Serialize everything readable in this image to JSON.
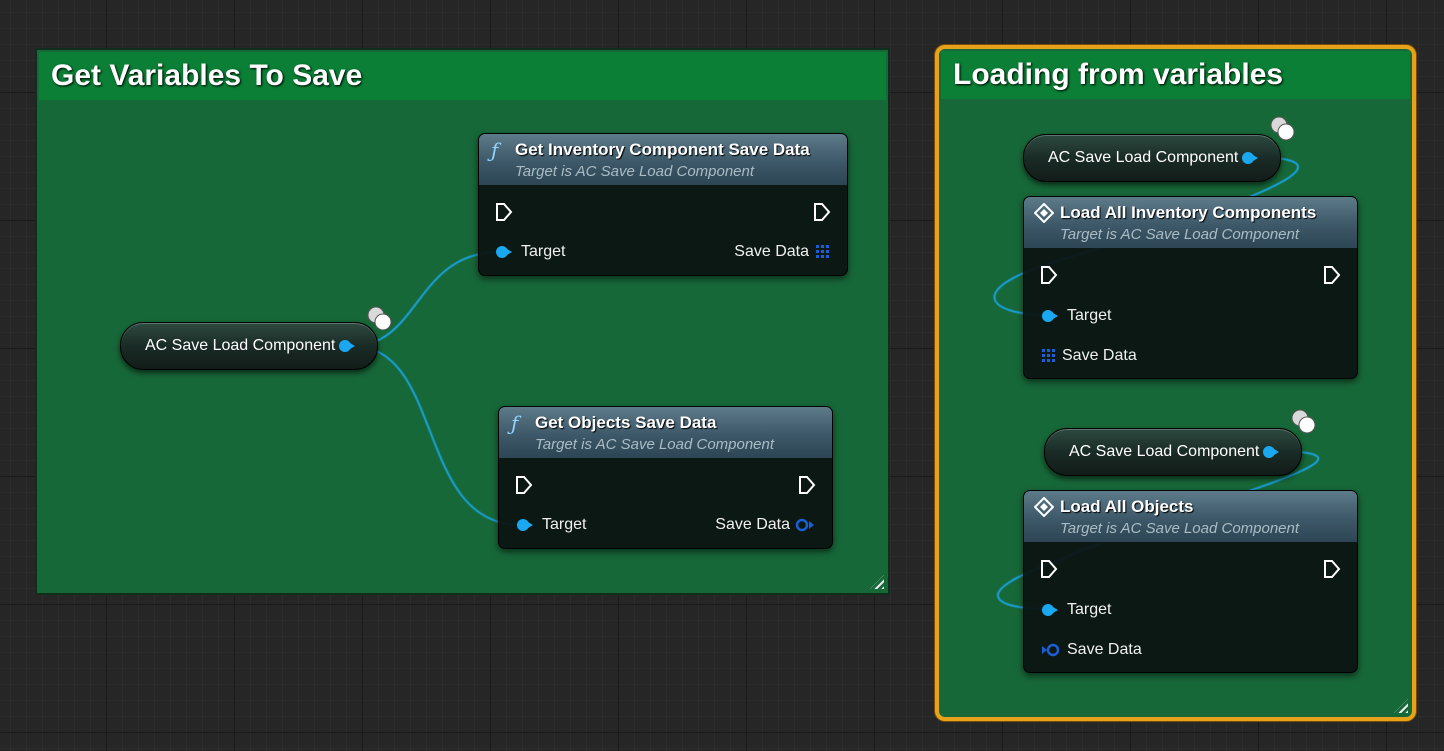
{
  "comments": {
    "save": {
      "title": "Get Variables To Save"
    },
    "load": {
      "title": "Loading from variables"
    }
  },
  "save_group": {
    "var_node": {
      "label": "AC Save Load Component"
    },
    "get_inventory": {
      "title": "Get Inventory Component Save Data",
      "subtitle": "Target is AC Save Load Component",
      "pin_target": "Target",
      "pin_output": "Save Data"
    },
    "get_objects": {
      "title": "Get Objects Save Data",
      "subtitle": "Target is AC Save Load Component",
      "pin_target": "Target",
      "pin_output": "Save Data"
    }
  },
  "load_group": {
    "var_node_1": {
      "label": "AC Save Load Component"
    },
    "load_inventory": {
      "title": "Load All Inventory Components",
      "subtitle": "Target is AC Save Load Component",
      "pin_target": "Target",
      "pin_input": "Save Data"
    },
    "var_node_2": {
      "label": "AC Save Load Component"
    },
    "load_objects": {
      "title": "Load All Objects",
      "subtitle": "Target is AC Save Load Component",
      "pin_target": "Target",
      "pin_input": "Save Data"
    }
  },
  "colors": {
    "comment_body": "#176839",
    "comment_header": "#0a7f35",
    "selection_outline": "#e6a21b",
    "object_pin": "#1aa8f0",
    "struct_pin": "#1b5fd6",
    "wire": "#1aa8f0"
  },
  "icons": {
    "function": "function-icon",
    "event": "event-diamond-icon",
    "exec": "exec-pin-icon",
    "array": "array-grid-icon",
    "struct": "struct-ring-icon",
    "variable": "object-reference-icon",
    "replicated": "replicated-cloud-icon"
  }
}
